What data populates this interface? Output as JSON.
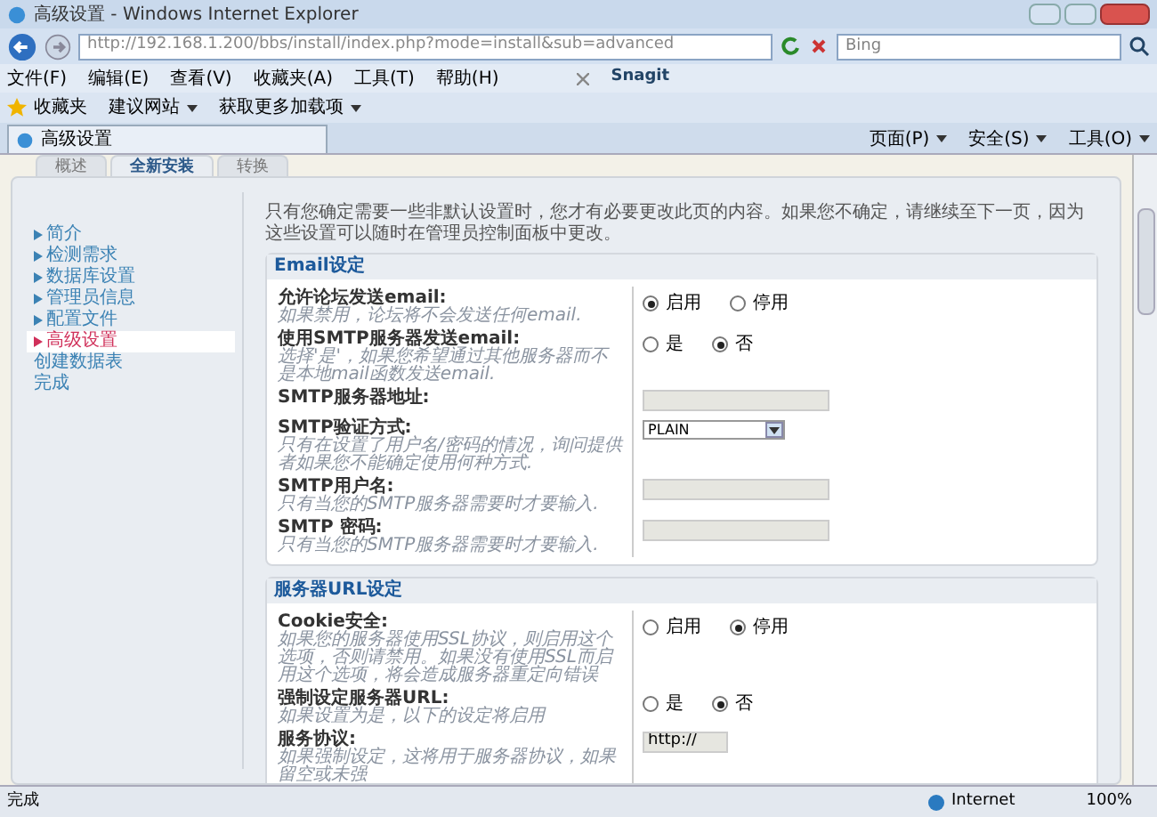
{
  "window": {
    "title": "高级设置 - Windows Internet Explorer"
  },
  "address_bar": {
    "url": "http://192.168.1.200/bbs/install/index.php?mode=install&sub=advanced"
  },
  "search": {
    "placeholder": "Bing"
  },
  "menu": [
    "文件(F)",
    "编辑(E)",
    "查看(V)",
    "收藏夹(A)",
    "工具(T)",
    "帮助(H)"
  ],
  "snagit": "Snagit",
  "favorites_bar": {
    "favorites": "收藏夹",
    "links": [
      {
        "label": "建议网站",
        "dropdown": true
      },
      {
        "label": "获取更多加载项",
        "dropdown": true
      }
    ]
  },
  "browser_tab": {
    "title": "高级设置"
  },
  "command_bar": [
    "页面(P)",
    "安全(S)",
    "工具(O)"
  ],
  "page_tabs": [
    {
      "label": "概述",
      "selected": false
    },
    {
      "label": "全新安装",
      "selected": true
    },
    {
      "label": "转换",
      "selected": false
    }
  ],
  "sidebar": {
    "items": [
      {
        "label": "简介",
        "done": true,
        "selected": false
      },
      {
        "label": "检测需求",
        "done": true,
        "selected": false
      },
      {
        "label": "数据库设置",
        "done": true,
        "selected": false
      },
      {
        "label": "管理员信息",
        "done": true,
        "selected": false
      },
      {
        "label": "配置文件",
        "done": true,
        "selected": false
      },
      {
        "label": "高级设置",
        "done": false,
        "selected": true
      },
      {
        "label": "创建数据表",
        "done": false,
        "selected": false
      },
      {
        "label": "完成",
        "done": false,
        "selected": false
      }
    ]
  },
  "intro": "只有您确定需要一些非默认设置时，您才有必要更改此页的内容。如果您不确定，请继续至下一页，因为这些设置可以随时在管理员控制面板中更改。",
  "sections": [
    {
      "title": "Email设定",
      "fields": [
        {
          "kind": "radio",
          "label": "允许论坛发送email:",
          "hint": "如果禁用，论坛将不会发送任何email.",
          "options": [
            {
              "label": "启用",
              "selected": true
            },
            {
              "label": "停用",
              "selected": false
            }
          ]
        },
        {
          "kind": "radio",
          "label": "使用SMTP服务器发送email:",
          "hint": "选择'是'，如果您希望通过其他服务器而不是本地mail函数发送email.",
          "options": [
            {
              "label": "是",
              "selected": false
            },
            {
              "label": "否",
              "selected": true
            }
          ]
        },
        {
          "kind": "text",
          "label": "SMTP服务器地址:"
        },
        {
          "kind": "select",
          "label": "SMTP验证方式:",
          "hint": "只有在设置了用户名/密码的情况，询问提供者如果您不能确定使用何种方式.",
          "value": "PLAIN"
        },
        {
          "kind": "text",
          "label": "SMTP用户名:",
          "hint": "只有当您的SMTP服务器需要时才要输入."
        },
        {
          "kind": "text",
          "label": "SMTP 密码:",
          "hint": "只有当您的SMTP服务器需要时才要输入."
        }
      ]
    },
    {
      "title": "服务器URL设定",
      "fields": [
        {
          "kind": "radio",
          "label": "Cookie安全:",
          "hint": "如果您的服务器使用SSL协议，则启用这个选项，否则请禁用。如果没有使用SSL而启用这个选项，将会造成服务器重定向错误",
          "options": [
            {
              "label": "启用",
              "selected": false
            },
            {
              "label": "停用",
              "selected": true
            }
          ]
        },
        {
          "kind": "radio",
          "label": "强制设定服务器URL:",
          "hint": "如果设置为是，以下的设定将启用",
          "options": [
            {
              "label": "是",
              "selected": false
            },
            {
              "label": "否",
              "selected": true
            }
          ]
        },
        {
          "kind": "text",
          "label": "服务协议:",
          "hint": "如果强制设定，这将用于服务器协议，如果留空或未强",
          "value": "http://"
        }
      ]
    }
  ],
  "status_bar": {
    "text": "完成",
    "zone": "Internet",
    "zoom": "100%"
  }
}
